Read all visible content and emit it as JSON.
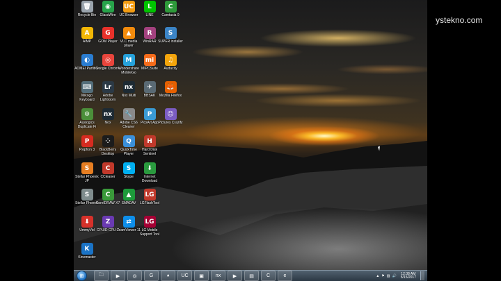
{
  "watermark": "ystekno.com",
  "colors": {
    "taskbar": "#3c4a57",
    "accent": "#1b6fc2"
  },
  "desktop_icons": [
    {
      "label": "Recycle Bin",
      "icon": "recycle-bin-icon",
      "color": "#9aa4ad",
      "glyph": "🗑"
    },
    {
      "label": "GlassWire",
      "icon": "glasswire-icon",
      "color": "#27a34a",
      "glyph": "◉"
    },
    {
      "label": "UC Browser",
      "icon": "uc-browser-icon",
      "color": "#f39c12",
      "glyph": "UC"
    },
    {
      "label": "LINE",
      "icon": "line-icon",
      "color": "#00c300",
      "glyph": "L"
    },
    {
      "label": "Camtasia 9",
      "icon": "camtasia-icon",
      "color": "#2e9a3a",
      "glyph": "C"
    },
    {
      "label": "AIMP",
      "icon": "aimp-icon",
      "color": "#f2b705",
      "glyph": "A"
    },
    {
      "label": "GOM Player",
      "icon": "gom-player-icon",
      "color": "#e8312a",
      "glyph": "G"
    },
    {
      "label": "VLC media player",
      "icon": "vlc-icon",
      "color": "#f28b0c",
      "glyph": "▲"
    },
    {
      "label": "WinRAR",
      "icon": "winrar-icon",
      "color": "#a3417e",
      "glyph": "R"
    },
    {
      "label": "SUPER installer",
      "icon": "super-icon",
      "color": "#3b84c6",
      "glyph": "S"
    },
    {
      "label": "AOMEI Partition",
      "icon": "aomei-icon",
      "color": "#2a7dd1",
      "glyph": "◐"
    },
    {
      "label": "Google Chrome",
      "icon": "chrome-icon",
      "color": "#e8453c",
      "glyph": "◎"
    },
    {
      "label": "Wondershare MobileGo",
      "icon": "mobilego-icon",
      "color": "#26a2db",
      "glyph": "M"
    },
    {
      "label": "MIPCSuite",
      "icon": "mipcsuite-icon",
      "color": "#f56c1b",
      "glyph": "mi"
    },
    {
      "label": "Audacity",
      "icon": "audacity-icon",
      "color": "#f3a50c",
      "glyph": "♫"
    },
    {
      "label": "Mikogo Keyboard",
      "icon": "keyboard-icon",
      "color": "#546e7a",
      "glyph": "⌨"
    },
    {
      "label": "Adobe Lightroom",
      "icon": "lightroom-icon",
      "color": "#2b3945",
      "glyph": "Lr"
    },
    {
      "label": "Nox Multi",
      "icon": "nox-multi-icon",
      "color": "#1d2a33",
      "glyph": "nx"
    },
    {
      "label": "BBSAK",
      "icon": "bbsak-icon",
      "color": "#5a6a74",
      "glyph": "✈"
    },
    {
      "label": "Mozilla Firefox",
      "icon": "firefox-icon",
      "color": "#e66000",
      "glyph": "🦊"
    },
    {
      "label": "Auslogics Duplicate Fi",
      "icon": "auslogics-icon",
      "color": "#4b8f3a",
      "glyph": "⚙"
    },
    {
      "label": "Nox",
      "icon": "nox-icon",
      "color": "#1d2a33",
      "glyph": "nx"
    },
    {
      "label": "Adobe CS6 Cleaner",
      "icon": "cleaner-tool-icon",
      "color": "#8a8a8a",
      "glyph": "🔧"
    },
    {
      "label": "PicsArt App",
      "icon": "picsart-icon",
      "color": "#3a9bd5",
      "glyph": "P"
    },
    {
      "label": "Pictures Crazify",
      "icon": "crazify-icon",
      "color": "#7b5cc2",
      "glyph": "☺"
    },
    {
      "label": "Psiphon 3",
      "icon": "psiphon-icon",
      "color": "#d62b20",
      "glyph": "P"
    },
    {
      "label": "BlackBerry Desktop",
      "icon": "blackberry-icon",
      "color": "#1c1c1c",
      "glyph": "⁘"
    },
    {
      "label": "QuickTime Player",
      "icon": "quicktime-icon",
      "color": "#3b8fd8",
      "glyph": "Q"
    },
    {
      "label": "Hard Disk Sentinel",
      "icon": "sentinel-icon",
      "color": "#c0392b",
      "glyph": "H"
    },
    {
      "label": "Stellar Phoenix JP",
      "icon": "stellar-jp-icon",
      "color": "#e67e22",
      "glyph": "S"
    },
    {
      "label": "CCleaner",
      "icon": "ccleaner-icon",
      "color": "#c0392b",
      "glyph": "C"
    },
    {
      "label": "Skype",
      "icon": "skype-icon",
      "color": "#00aff0",
      "glyph": "S"
    },
    {
      "label": "Internet Download",
      "icon": "idm-icon",
      "color": "#2a9a3e",
      "glyph": "⬇"
    },
    {
      "label": "Stellar Phoenix",
      "icon": "stellar-icon",
      "color": "#7f8c8d",
      "glyph": "S"
    },
    {
      "label": "CorelDRAW X7",
      "icon": "coreldraw-icon",
      "color": "#3a9a3a",
      "glyph": "C"
    },
    {
      "label": "SMADAV",
      "icon": "smadav-icon",
      "color": "#1d9a3a",
      "glyph": "▲"
    },
    {
      "label": "LGFlashTool",
      "icon": "lgflashtool-icon",
      "color": "#c0392b",
      "glyph": "LG"
    },
    {
      "label": "UmmyVid",
      "icon": "ummyvid-icon",
      "color": "#d6312a",
      "glyph": "⬇"
    },
    {
      "label": "CPUID CPU-Z",
      "icon": "cpuz-icon",
      "color": "#6a3ab2",
      "glyph": "Z"
    },
    {
      "label": "TeamViewer 11",
      "icon": "teamviewer-icon",
      "color": "#0e8ee9",
      "glyph": "⇄"
    },
    {
      "label": "LG Mobile Support Tool",
      "icon": "lg-mobile-icon",
      "color": "#a50034",
      "glyph": "LG"
    },
    {
      "label": "Kinemaster",
      "icon": "kinemaster-icon",
      "color": "#1a73c6",
      "glyph": "K"
    }
  ],
  "taskbar": {
    "start_label": "Start",
    "items": [
      {
        "name": "explorer-taskbar-icon",
        "glyph": "🗀"
      },
      {
        "name": "media-taskbar-icon",
        "glyph": "▶"
      },
      {
        "name": "chrome-taskbar-icon",
        "glyph": "◎"
      },
      {
        "name": "gom-taskbar-icon",
        "glyph": "G"
      },
      {
        "name": "firefox-taskbar-icon",
        "glyph": "◕"
      },
      {
        "name": "uc-taskbar-icon",
        "glyph": "UC"
      },
      {
        "name": "app-taskbar-icon",
        "glyph": "▣"
      },
      {
        "name": "nox-taskbar-icon",
        "glyph": "nx"
      },
      {
        "name": "camtasia-taskbar-icon",
        "glyph": "▶"
      },
      {
        "name": "photos-taskbar-icon",
        "glyph": "▤"
      },
      {
        "name": "camtasia-recorder-taskbar-icon",
        "glyph": "C"
      },
      {
        "name": "edge-taskbar-icon",
        "glyph": "e"
      }
    ],
    "time": "12:38 AM",
    "date": "5/15/2017"
  }
}
